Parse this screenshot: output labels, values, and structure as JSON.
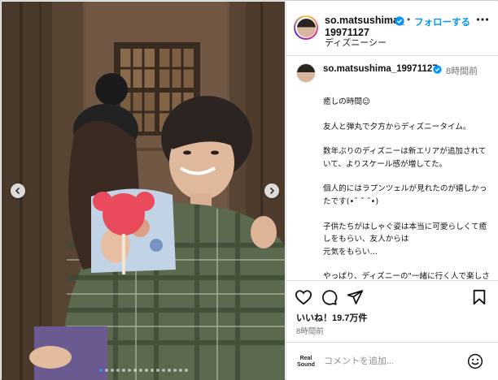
{
  "header": {
    "username": "so.matsushima_19971127",
    "separator": "•",
    "follow_label": "フォローする",
    "location": "ディズニーシー"
  },
  "caption": {
    "username": "so.matsushima_19971127",
    "time_ago": "8時間前",
    "paragraphs": [
      "癒しの時間☺",
      "友人と弾丸で夕方からディズニータイム。",
      "数年ぶりのディズニーは新エリアが追加されていて、よりスケール感が増してた。",
      "個人的にはラプンツェルが見れたのが嬉しかったです(•˘ ˘ ˘•)",
      "子供たちがはしゃぐ姿は本当に可愛らしくて癒しをもらい、友人からは\n元気をもらい…",
      "やっぱり、ディズニーの\"一緒に行く人で楽しさが決まる\"って\n本当だ"
    ]
  },
  "actions": {
    "likes": "いいね！19.7万件",
    "time": "8時間前"
  },
  "comment": {
    "avatar_label": "Real Sound",
    "placeholder": "コメントを追加..."
  },
  "carousel": {
    "slide_count": 16,
    "active_index": 0
  },
  "icons": {
    "prev": "chevron-left-icon",
    "next": "chevron-right-icon",
    "verified": "verified-badge-icon",
    "more": "more-horizontal-icon",
    "like": "heart-icon",
    "comment": "comment-icon",
    "share": "share-icon",
    "save": "bookmark-icon",
    "emoji": "emoji-icon"
  },
  "colors": {
    "link_blue": "#0095f6",
    "verified_blue": "#0095f6",
    "muted_text": "#737373",
    "divider": "#dbdbdb"
  }
}
